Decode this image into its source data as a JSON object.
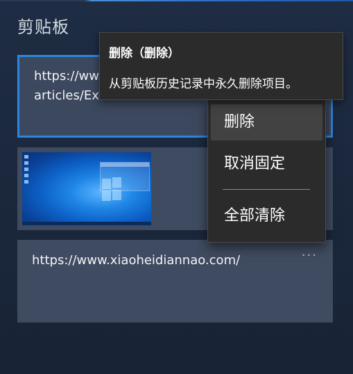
{
  "panel": {
    "title": "剪贴板"
  },
  "items": [
    {
      "line1": "https://ww",
      "line2": "articles/Ex",
      "selected": true
    },
    {
      "kind": "screenshot-image"
    },
    {
      "line1": "https://www.xiaoheidiannao.com/",
      "more": "···"
    }
  ],
  "tooltip": {
    "title": "删除（删除）",
    "body": "从剪贴板历史记录中永久删除项目。"
  },
  "context_menu": {
    "items": [
      {
        "label": "删除",
        "hovered": true
      },
      {
        "label": "取消固定"
      },
      {
        "label": "全部清除"
      }
    ]
  },
  "colors": {
    "background": "#1b283d",
    "card": "#3f4b60",
    "selection_border": "#2d86e0",
    "menu": "#2b2b2b",
    "menu_hover": "#424242"
  },
  "icons": {
    "more": "more-horizontal-icon"
  }
}
